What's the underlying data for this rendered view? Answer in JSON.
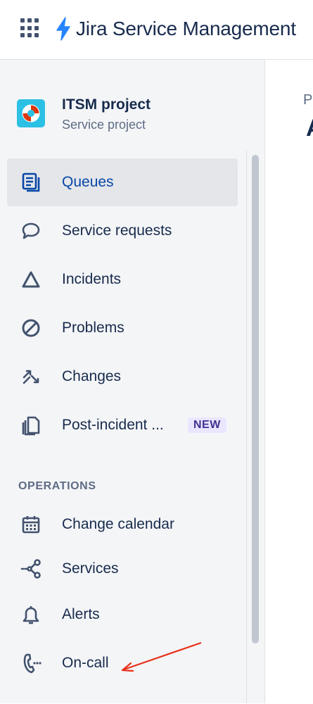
{
  "header": {
    "product_title": "Jira Service Management",
    "brand_color": "#2684ff"
  },
  "project": {
    "name": "ITSM project",
    "type": "Service project",
    "avatar_color": "#2bc0e4"
  },
  "nav": {
    "items": [
      {
        "label": "Queues",
        "icon": "queues-icon",
        "selected": true
      },
      {
        "label": "Service requests",
        "icon": "speech-bubble-icon"
      },
      {
        "label": "Incidents",
        "icon": "triangle-icon"
      },
      {
        "label": "Problems",
        "icon": "prohibited-icon"
      },
      {
        "label": "Changes",
        "icon": "changes-arrows-icon"
      },
      {
        "label": "Post-incident ...",
        "icon": "documents-icon",
        "badge": "NEW"
      }
    ],
    "operations_heading": "OPERATIONS",
    "operations": [
      {
        "label": "Change calendar",
        "icon": "calendar-icon"
      },
      {
        "label": "Services",
        "icon": "services-icon"
      },
      {
        "label": "Alerts",
        "icon": "bell-icon"
      },
      {
        "label": "On-call",
        "icon": "phone-icon"
      }
    ]
  },
  "main": {
    "crumb_partial": "P",
    "heading_partial": "A"
  },
  "annotation": {
    "arrow_color": "#e8311a"
  }
}
